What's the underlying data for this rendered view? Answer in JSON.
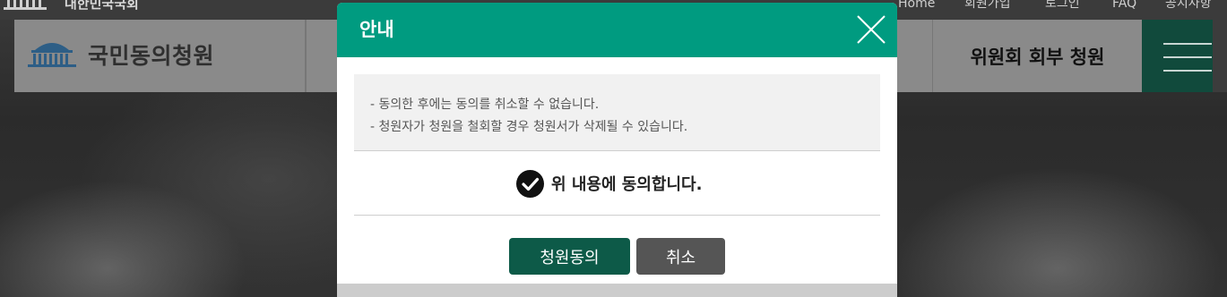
{
  "top_bar": {
    "government_name": "대한민국국회",
    "links": [
      "Home",
      "회원가입",
      "로그인",
      "FAQ",
      "공지사항"
    ]
  },
  "site": {
    "logo_text": "국민동의청원",
    "nav_item": "위원회 회부 청원",
    "menu_icon": "hamburger-icon"
  },
  "modal": {
    "title": "안내",
    "close_icon": "close-icon",
    "notices": [
      "- 동의한 후에는 동의를 취소할 수 없습니다.",
      "- 청원자가 청원을 철회할 경우 청원서가 삭제될 수 있습니다."
    ],
    "agree_label": "위 내용에 동의합니다.",
    "agree_checked": true,
    "confirm_label": "청원동의",
    "cancel_label": "취소"
  },
  "colors": {
    "modal_header": "#009b80",
    "confirm_button": "#0d5a48",
    "cancel_button": "#555555",
    "menu_button": "#114a3c"
  }
}
